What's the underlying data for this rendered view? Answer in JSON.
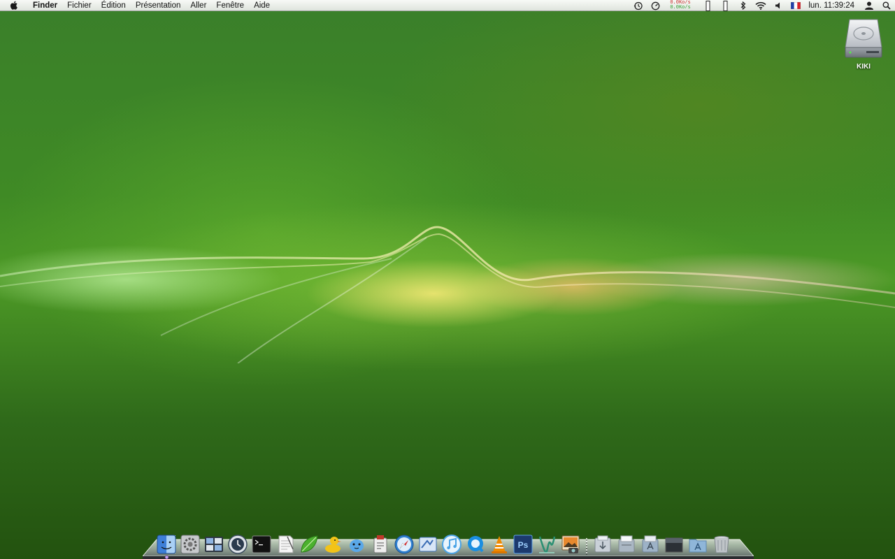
{
  "menubar": {
    "app_name": "Finder",
    "menus": [
      "Fichier",
      "Édition",
      "Présentation",
      "Aller",
      "Fenêtre",
      "Aide"
    ],
    "network": {
      "upload": "0.0Ko/s",
      "download": "0.0Ko/s"
    },
    "clock": "lun. 11:39:24",
    "status_icons": [
      "time-machine-icon",
      "activity-meter-icon",
      "network-rate-icon",
      "memory-bar-icon",
      "cpu-bar-icon",
      "bluetooth-icon",
      "wifi-icon",
      "volume-icon",
      "french-flag-icon",
      "user-icon",
      "spotlight-icon"
    ]
  },
  "desktop": {
    "items": [
      {
        "label": "KIKI",
        "icon": "hard-drive-icon"
      }
    ]
  },
  "dock": {
    "apps": [
      {
        "name": "finder-icon",
        "color": "#3e7fd8"
      },
      {
        "name": "system-preferences-icon",
        "color": "#8a8a8a"
      },
      {
        "name": "spaces-icon",
        "color": "#5b6b83"
      },
      {
        "name": "time-machine-icon",
        "color": "#3a4a5c"
      },
      {
        "name": "terminal-icon",
        "color": "#111111"
      },
      {
        "name": "textedit-icon",
        "color": "#e8e8e8"
      },
      {
        "name": "leaf-icon",
        "color": "#4bb12e"
      },
      {
        "name": "cyberduck-icon",
        "color": "#f2c318"
      },
      {
        "name": "adium-icon",
        "color": "#5aa8e8"
      },
      {
        "name": "script-editor-icon",
        "color": "#c0392b"
      },
      {
        "name": "safari-icon",
        "color": "#2f80d1"
      },
      {
        "name": "mail-icon",
        "color": "#3b6db5"
      },
      {
        "name": "itunes-icon",
        "color": "#4aa3e6"
      },
      {
        "name": "quicktime-icon",
        "color": "#1b8ee0"
      },
      {
        "name": "vlc-icon",
        "color": "#f08a00"
      },
      {
        "name": "photoshop-icon",
        "color": "#1c3a6e"
      },
      {
        "name": "dreamweaver-icon",
        "color": "#2a8f72"
      },
      {
        "name": "iphoto-icon",
        "color": "#7a5a34"
      }
    ],
    "stacks": [
      {
        "name": "downloads-stack-icon",
        "color": "#c9d0d8"
      },
      {
        "name": "documents-stack-icon",
        "color": "#aab7c4"
      },
      {
        "name": "applications-stack-icon",
        "color": "#9db2c7"
      },
      {
        "name": "screen-stack-icon",
        "color": "#2b3036"
      },
      {
        "name": "apps-folder-icon",
        "color": "#8fb6d9"
      },
      {
        "name": "trash-icon",
        "color": "#bfc4c8"
      }
    ]
  }
}
